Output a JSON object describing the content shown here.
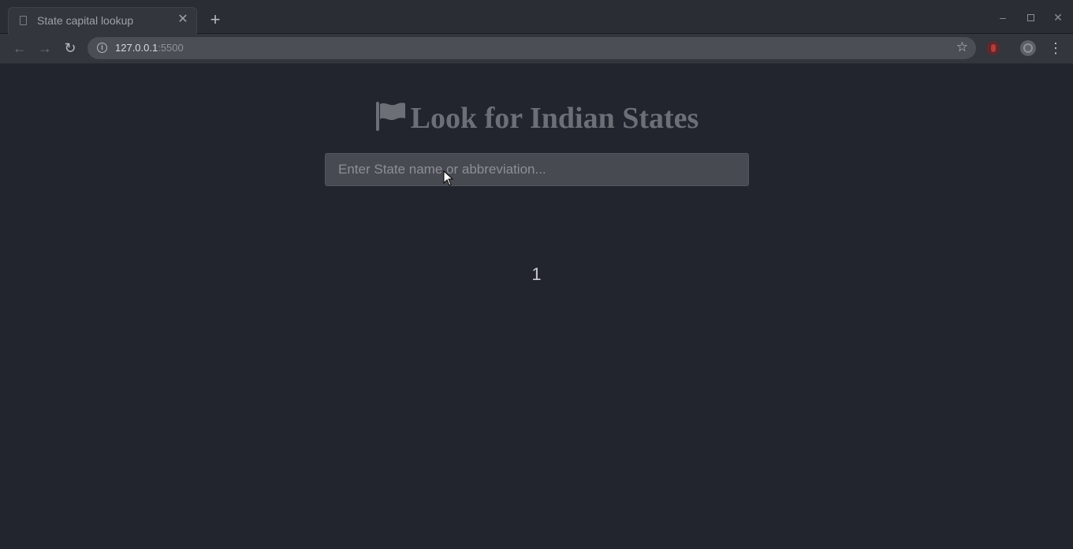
{
  "browser": {
    "tab_title": "State capital lookup",
    "url_host": "127.0.0.1",
    "url_port": ":5500"
  },
  "page": {
    "heading": "Look for Indian States",
    "search": {
      "placeholder": "Enter State name or abbreviation...",
      "value": ""
    },
    "result_text": "1"
  },
  "colors": {
    "background": "#22252d",
    "heading": "#6c6f76",
    "input_bg": "#474a51"
  },
  "icons": {
    "heading_icon": "flag-icon"
  }
}
